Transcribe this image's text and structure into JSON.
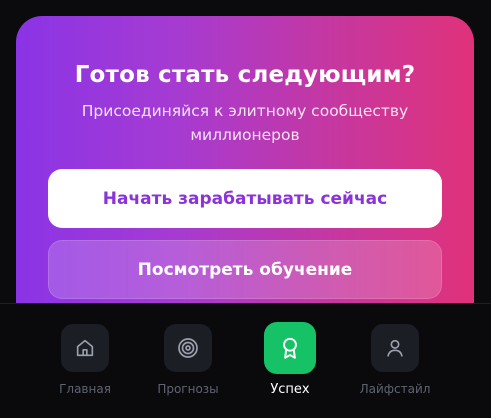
{
  "promo": {
    "title": "Готов стать следующим?",
    "subtitle": "Присоединяйся к элитному сообществу миллионеров",
    "primary_button": "Начать зарабатывать сейчас",
    "secondary_button": "Посмотреть обучение"
  },
  "tabbar": {
    "tabs": [
      {
        "label": "Главная",
        "icon": "home-icon",
        "active": false
      },
      {
        "label": "Прогнозы",
        "icon": "target-icon",
        "active": false
      },
      {
        "label": "Успех",
        "icon": "award-icon",
        "active": true
      },
      {
        "label": "Лайфстайл",
        "icon": "user-icon",
        "active": false
      }
    ]
  },
  "colors": {
    "gradient_start": "#8a34e6",
    "gradient_end": "#e0327a",
    "active_tab": "#16c266",
    "inactive_tab_bg": "#1c1e25",
    "primary_button_text": "#8b33d6"
  }
}
